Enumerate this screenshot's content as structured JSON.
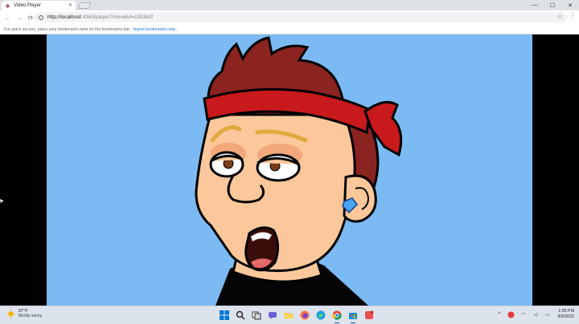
{
  "browser": {
    "tab": {
      "title": "Video Player",
      "close_glyph": "✕"
    },
    "window_controls": {
      "minimize": "—",
      "maximize": "☐",
      "close": "✕"
    },
    "nav": {
      "back": "←",
      "forward": "→",
      "reload": "⟳"
    },
    "address": {
      "host": "http://localhost",
      "rest": ":4343/player?movieId=c353b2f"
    },
    "menu_glyph": "⋮",
    "star_glyph": "☆",
    "bookmarks_bar": {
      "message": "For quick access, place your bookmarks here on the bookmarks bar.",
      "link": "Import bookmarks now..."
    }
  },
  "video": {
    "scene": "cartoon character",
    "colors": {
      "background": "#7cbaf3",
      "hair": "#8b2321",
      "headband": "#c8191c",
      "skin": "#fcc79a"
    }
  },
  "taskbar": {
    "weather": {
      "temp": "87°F",
      "desc": "Mostly sunny"
    },
    "apps": [
      "windows-start-icon",
      "search-icon",
      "task-view-icon",
      "chat-icon",
      "file-explorer-icon",
      "firefox-icon",
      "edge-icon",
      "chrome-icon",
      "store-icon",
      "app-icon"
    ],
    "tray_glyphs": {
      "chevron": "^",
      "wifi": "◠",
      "volume": "◁",
      "battery": "▭"
    },
    "clock": {
      "time": "1:05 PM",
      "date": "9/3/2022"
    }
  }
}
